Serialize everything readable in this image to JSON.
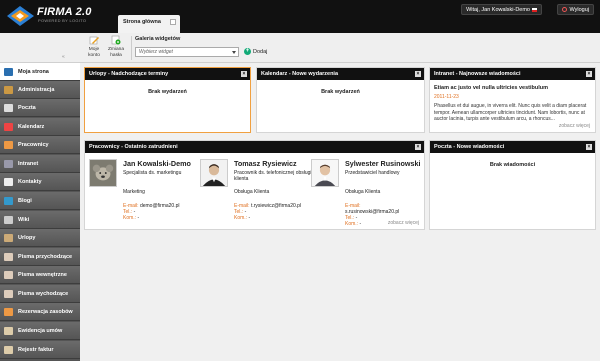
{
  "header": {
    "logo_text": "FIRMA 2.0",
    "logo_sub": "POWERED BY LOGITO",
    "user": "Witaj, Jan Kowalski-Demo",
    "logout": "Wyloguj"
  },
  "tab": {
    "label": "Strona główna"
  },
  "toolbar": {
    "my_account": [
      "Moje",
      "konto"
    ],
    "change_password": [
      "Zmiana",
      "hasła"
    ],
    "gallery_title": "Galeria widgetów",
    "select_placeholder": "Wybierz widget",
    "add_label": "Dodaj",
    "collapse": "«"
  },
  "sidebar": {
    "items": [
      {
        "label": "Moja strona",
        "icon": "home-icon",
        "color": "#2a6fb0"
      },
      {
        "label": "Administracja",
        "icon": "admin-icon",
        "color": "#c94"
      },
      {
        "label": "Poczta",
        "icon": "mail-icon",
        "color": "#ddd"
      },
      {
        "label": "Kalendarz",
        "icon": "calendar-icon",
        "color": "#e44"
      },
      {
        "label": "Pracownicy",
        "icon": "people-icon",
        "color": "#e94"
      },
      {
        "label": "Intranet",
        "icon": "intranet-icon",
        "color": "#99a"
      },
      {
        "label": "Kontakty",
        "icon": "contacts-icon",
        "color": "#eee"
      },
      {
        "label": "Blogi",
        "icon": "blog-icon",
        "color": "#39c"
      },
      {
        "label": "Wiki",
        "icon": "wiki-icon",
        "color": "#ccc"
      },
      {
        "label": "Urlopy",
        "icon": "vacation-icon",
        "color": "#ca7"
      },
      {
        "label": "Pisma przychodzące",
        "icon": "incoming-icon",
        "color": "#dcb"
      },
      {
        "label": "Pisma wewnętrzne",
        "icon": "internal-icon",
        "color": "#dcb"
      },
      {
        "label": "Pisma wychodzące",
        "icon": "outgoing-icon",
        "color": "#dcb"
      },
      {
        "label": "Rezerwacja zasobów",
        "icon": "resources-icon",
        "color": "#e94"
      },
      {
        "label": "Ewidencja umów",
        "icon": "contracts-icon",
        "color": "#dca"
      },
      {
        "label": "Rejestr faktur",
        "icon": "invoices-icon",
        "color": "#dca"
      }
    ]
  },
  "widgets": {
    "urlopy": {
      "title": "Urlopy - Nadchodzące terminy",
      "empty": "Brak wydarzeń"
    },
    "kalendarz": {
      "title": "Kalendarz - Nowe wydarzenia",
      "empty": "Brak wydarzeń"
    },
    "intranet": {
      "title": "Intranet - Najnowsze wiadomości",
      "news_title": "Etiam ac justo vel nulla ultricies vestibulum",
      "news_date": "2011-11-23",
      "news_text": "Phasellus et dui augue, in viverra elit. Nunc quis velit a diam placerat tempor. Aenean ullamcorper ultricies tincidunt. Nam lobortis, nunc at auctor lacinia, turpis ante vestibulum arcu, a rhoncus...",
      "more": "zobacz więcej"
    },
    "pracownicy": {
      "title": "Pracownicy - Ostatnio zatrudnieni",
      "more": "zobacz więcej",
      "email_label": "E-mail:",
      "tel_label": "Tel.:",
      "kom_label": "Kom.:",
      "employees": [
        {
          "name": "Jan Kowalski-Demo",
          "position": "Specjalista ds. marketingu",
          "dept": "Marketing",
          "email": "demo@firma20.pl",
          "tel": "-",
          "kom": "-"
        },
        {
          "name": "Tomasz Rysiewicz",
          "position": "Pracownik ds. telefonicznej obsługi klienta",
          "dept": "Obsługa Klienta",
          "email": "t.rysiewicz@firma20.pl",
          "tel": "-",
          "kom": "-"
        },
        {
          "name": "Sylwester Rusinowski",
          "position": "Przedstawiciel handlowy",
          "dept": "Obsługa Klienta",
          "email": "s.rusinowski@firma20.pl",
          "tel": "-",
          "kom": "-"
        }
      ]
    },
    "poczta": {
      "title": "Poczta - Nowe wiadomości",
      "empty": "Brak wiadomości"
    }
  }
}
